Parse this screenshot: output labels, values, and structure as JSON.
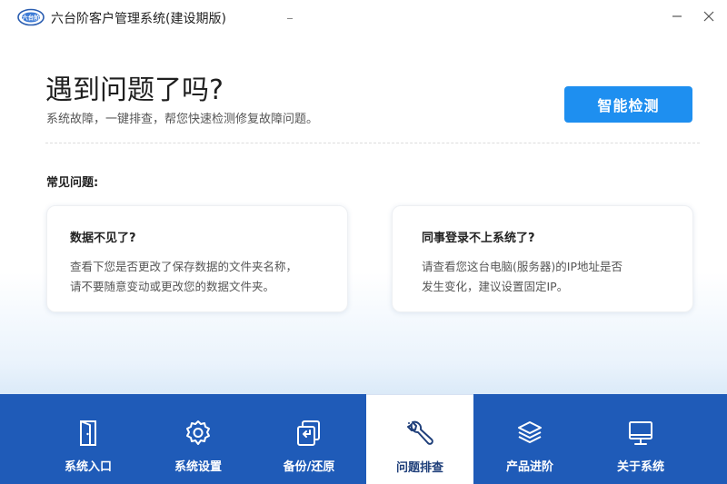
{
  "window": {
    "title": "六台阶客户管理系统(建设期版)",
    "logo_icon": "app-logo-icon",
    "minimize_icon": "minimize-icon",
    "close_icon": "close-icon"
  },
  "hero": {
    "headline": "遇到问题了吗?",
    "subline": "系统故障，一键排查，帮您快速检测修复故障问题。",
    "detect_button": "智能检测"
  },
  "faq": {
    "heading": "常见问题:",
    "cards": [
      {
        "title": "数据不见了?",
        "lines": [
          "查看下您是否更改了保存数据的文件夹名称，",
          "请不要随意变动或更改您的数据文件夹。"
        ]
      },
      {
        "title": "同事登录不上系统了?",
        "lines": [
          "请查看您这台电脑(服务器)的IP地址是否",
          "发生变化，建议设置固定IP。"
        ]
      }
    ]
  },
  "nav": {
    "items": [
      {
        "label": "系统入口",
        "icon": "door-icon",
        "active": false
      },
      {
        "label": "系统设置",
        "icon": "gear-icon",
        "active": false
      },
      {
        "label": "备份/还原",
        "icon": "backup-restore-icon",
        "active": false
      },
      {
        "label": "问题排查",
        "icon": "wrench-icon",
        "active": true
      },
      {
        "label": "产品进阶",
        "icon": "layers-icon",
        "active": false
      },
      {
        "label": "关于系统",
        "icon": "monitor-icon",
        "active": false
      }
    ]
  },
  "colors": {
    "accent": "#1e8ff0",
    "nav_background": "#1f5bb8",
    "active_tab_background": "#ffffff",
    "active_icon": "#1f3f7a"
  }
}
